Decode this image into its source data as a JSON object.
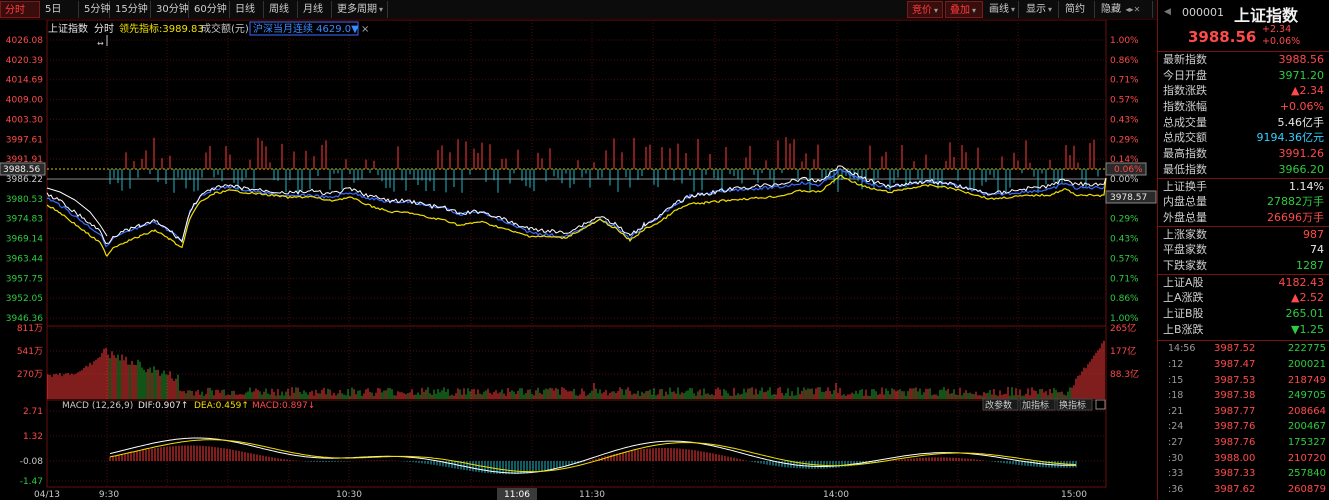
{
  "toolbar": {
    "left_tabs": [
      "分时",
      "5日",
      "5分钟",
      "15分钟",
      "30分钟",
      "60分钟",
      "日线",
      "周线",
      "月线",
      "更多周期"
    ],
    "active_tab": "分时",
    "right_buttons": [
      "竞价",
      "叠加",
      "画线",
      "显示",
      "简约",
      "隐藏"
    ]
  },
  "legend": {
    "name": "上证指数",
    "mode": "分时",
    "lead_label": "领先指标:3989.83",
    "vol_label": "成交额(元)",
    "overlay_label": "沪深当月连续 4629.0▼",
    "close_x": "×"
  },
  "price_axis": {
    "left_ticks": [
      "4026.08",
      "4020.39",
      "4014.69",
      "4009.00",
      "4003.30",
      "3997.61",
      "3991.91",
      "3986.22",
      "3980.53",
      "3974.83",
      "3969.14",
      "3963.44",
      "3957.75",
      "3952.05",
      "3946.36"
    ],
    "right_ticks": [
      "1.00%",
      "0.86%",
      "0.71%",
      "0.57%",
      "0.43%",
      "0.29%",
      "0.14%",
      "0.00%",
      "0.14%",
      "0.29%",
      "0.43%",
      "0.57%",
      "0.71%",
      "0.86%",
      "1.00%"
    ],
    "current_price_tag": "3988.56",
    "current_pct_tag": "0.06%",
    "low_tag": "3978.57"
  },
  "volume_axis": {
    "left_ticks": [
      "811万",
      "541万",
      "270万"
    ],
    "right_ticks": [
      "265亿",
      "177亿",
      "88.3亿"
    ]
  },
  "macd": {
    "title": "MACD (12,26,9)",
    "dif": "DIF:0.907↑",
    "dea": "DEA:0.459↑",
    "macd": "MACD:0.897↓",
    "buttons": [
      "改参数",
      "加指标",
      "换指标"
    ],
    "left_ticks": [
      "2.71",
      "1.32",
      "-0.08",
      "-1.47"
    ]
  },
  "time_axis": {
    "date": "04/13",
    "labels": [
      "9:30",
      "10:30",
      "11:06",
      "11:30",
      "14:00",
      "15:00"
    ],
    "hover_label": "11:06"
  },
  "panel": {
    "code": "000001",
    "name": "上证指数",
    "price": "3988.56",
    "change": "+2.34",
    "change_pct": "+0.06%",
    "stats": [
      {
        "label": "最新指数",
        "value": "3988.56",
        "color": "red"
      },
      {
        "label": "今日开盘",
        "value": "3971.20",
        "color": "green"
      },
      {
        "label": "指数涨跌",
        "value": "▲2.34",
        "color": "red"
      },
      {
        "label": "指数涨幅",
        "value": "+0.06%",
        "color": "red"
      },
      {
        "label": "总成交量",
        "value": "5.46亿手",
        "color": "white"
      },
      {
        "label": "总成交额",
        "value": "9194.36亿元",
        "color": "cyan"
      },
      {
        "label": "最高指数",
        "value": "3991.26",
        "color": "red"
      },
      {
        "label": "最低指数",
        "value": "3966.20",
        "color": "green"
      }
    ],
    "stats2": [
      {
        "label": "上证换手",
        "value": "1.14%",
        "color": "white"
      },
      {
        "label": "内盘总量",
        "value": "27882万手",
        "color": "green"
      },
      {
        "label": "外盘总量",
        "value": "26696万手",
        "color": "red"
      }
    ],
    "stats3": [
      {
        "label": "上涨家数",
        "value": "987",
        "color": "red"
      },
      {
        "label": "平盘家数",
        "value": "74",
        "color": "white"
      },
      {
        "label": "下跌家数",
        "value": "1287",
        "color": "green"
      }
    ],
    "stats4": [
      {
        "label": "上证A股",
        "value": "4182.43",
        "color": "red"
      },
      {
        "label": "上A涨跌",
        "value": "▲2.52",
        "color": "red"
      },
      {
        "label": "上证B股",
        "value": "265.01",
        "color": "green"
      },
      {
        "label": "上B涨跌",
        "value": "▼1.25",
        "color": "green"
      }
    ],
    "ticks": [
      {
        "time": "14:56",
        "price": "3987.52",
        "vol": "222775",
        "color": "green"
      },
      {
        "time": ":12",
        "price": "3987.47",
        "vol": "200021",
        "color": "green"
      },
      {
        "time": ":15",
        "price": "3987.53",
        "vol": "218749",
        "color": "red"
      },
      {
        "time": ":18",
        "price": "3987.38",
        "vol": "249705",
        "color": "green"
      },
      {
        "time": ":21",
        "price": "3987.77",
        "vol": "208664",
        "color": "red"
      },
      {
        "time": ":24",
        "price": "3987.76",
        "vol": "200467",
        "color": "green"
      },
      {
        "time": ":27",
        "price": "3987.76",
        "vol": "175327",
        "color": "green"
      },
      {
        "time": ":30",
        "price": "3988.00",
        "vol": "210720",
        "color": "red"
      },
      {
        "time": ":33",
        "price": "3987.33",
        "vol": "257840",
        "color": "green"
      },
      {
        "time": ":36",
        "price": "3987.62",
        "vol": "260879",
        "color": "red"
      }
    ]
  },
  "chart_data": {
    "type": "line",
    "price_range": [
      3946.36,
      4026.08
    ],
    "prev_close": 3986.22,
    "colors": {
      "price": "#ffffff",
      "lead": "#f0e000",
      "overlay": "#3a6bff",
      "up": "#ff3a3a",
      "down": "#1fb8c8"
    }
  }
}
